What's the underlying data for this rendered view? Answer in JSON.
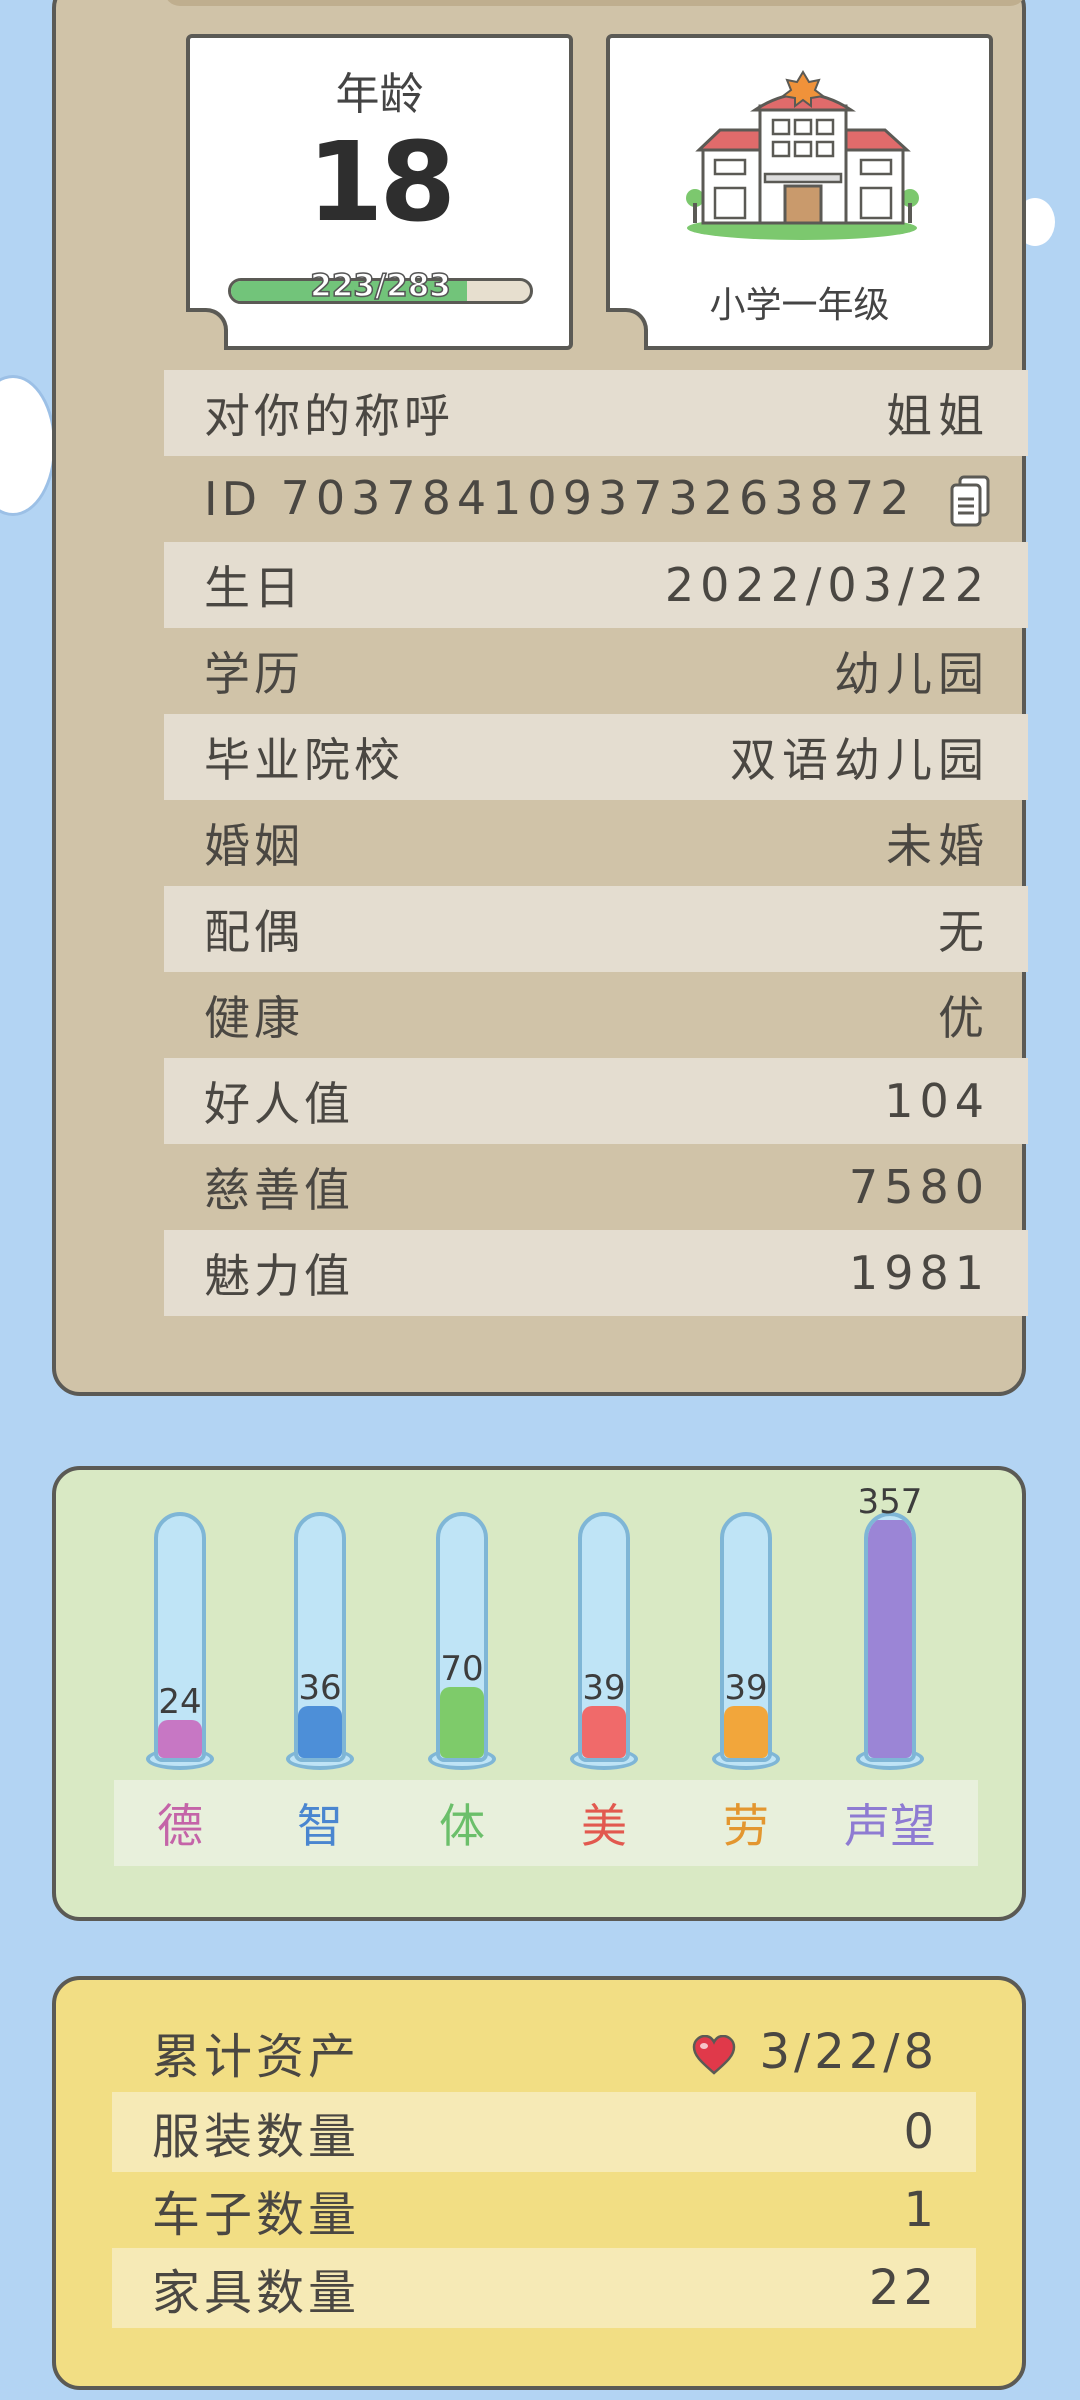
{
  "age": {
    "label": "年龄",
    "value": "18",
    "exp_text": "223/283",
    "exp_current": 223,
    "exp_max": 283
  },
  "school": {
    "label": "小学一年级",
    "icon": "school-building-icon"
  },
  "info_rows": [
    {
      "label": "对你的称呼",
      "value": "姐姐"
    },
    {
      "label": "ID",
      "value": "703784109373263872"
    },
    {
      "label": "生日",
      "value": "2022/03/22"
    },
    {
      "label": "学历",
      "value": "幼儿园"
    },
    {
      "label": "毕业院校",
      "value": "双语幼儿园"
    },
    {
      "label": "婚姻",
      "value": "未婚"
    },
    {
      "label": "配偶",
      "value": "无"
    },
    {
      "label": "健康",
      "value": "优"
    },
    {
      "label": "好人值",
      "value": "104"
    },
    {
      "label": "慈善值",
      "value": "7580"
    },
    {
      "label": "魅力值",
      "value": "1981"
    }
  ],
  "stats": [
    {
      "label": "德",
      "value": "24",
      "level": 0.16,
      "color": "#c777c4",
      "label_color": "#c464a8"
    },
    {
      "label": "智",
      "value": "36",
      "level": 0.22,
      "color": "#4d8fd8",
      "label_color": "#4a86d0"
    },
    {
      "label": "体",
      "value": "70",
      "level": 0.3,
      "color": "#7ecb6a",
      "label_color": "#6bbf6a"
    },
    {
      "label": "美",
      "value": "39",
      "level": 0.22,
      "color": "#f06a6a",
      "label_color": "#e2594f"
    },
    {
      "label": "劳",
      "value": "39",
      "level": 0.22,
      "color": "#f2a63b",
      "label_color": "#e3962f"
    },
    {
      "label": "声望",
      "value": "357",
      "level": 1.0,
      "color": "#9b85d6",
      "label_color": "#8e7bd2"
    }
  ],
  "assets": [
    {
      "label": "累计资产",
      "value": "3/22/8",
      "icon": "heart-icon"
    },
    {
      "label": "服装数量",
      "value": "0"
    },
    {
      "label": "车子数量",
      "value": "1"
    },
    {
      "label": "家具数量",
      "value": "22"
    }
  ],
  "colors": {
    "background": "#b3d4f3",
    "profile_card": "#d0c3a8",
    "stats_card": "#d9e9c4",
    "asset_card": "#f2de84"
  }
}
